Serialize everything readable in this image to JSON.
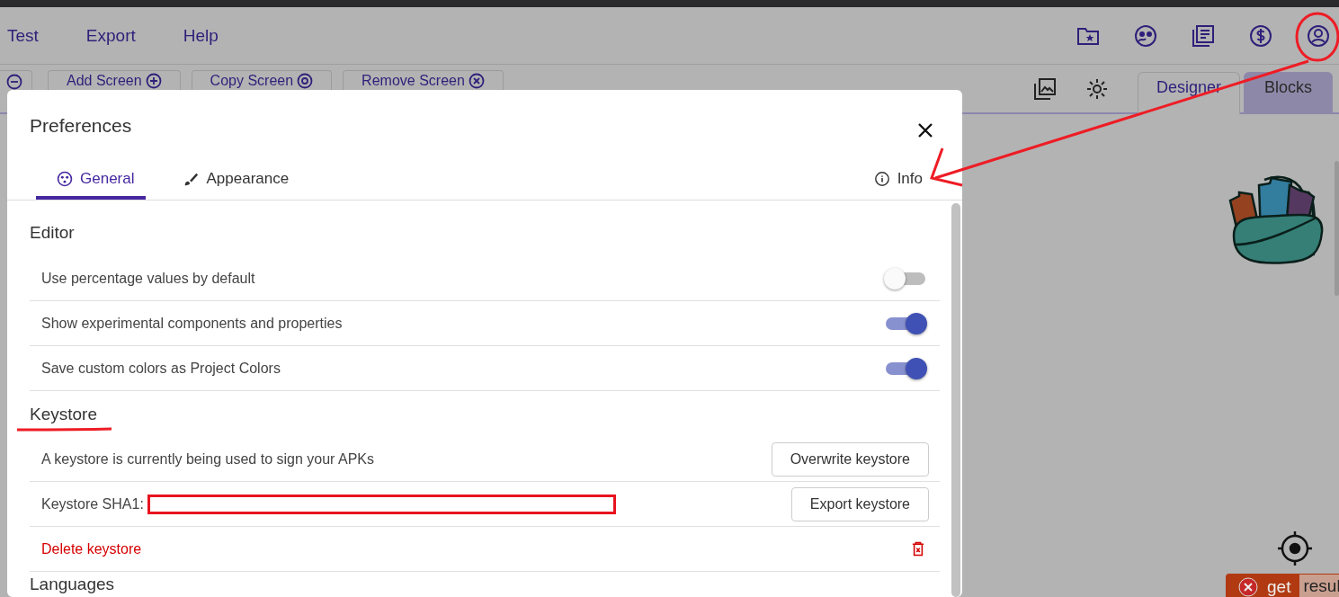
{
  "menu": [
    {
      "label": "Test"
    },
    {
      "label": "Export"
    },
    {
      "label": "Help"
    }
  ],
  "toolbar": {
    "buttons": [
      {
        "label": "Add Screen"
      },
      {
        "label": "Copy Screen"
      },
      {
        "label": "Remove Screen"
      }
    ],
    "view_tabs": [
      {
        "label": "Designer",
        "selected": false
      },
      {
        "label": "Blocks",
        "selected": true
      }
    ]
  },
  "canvas": {
    "block": {
      "label": "get",
      "argument": "resul"
    }
  },
  "dialog": {
    "title": "Preferences",
    "tabs": [
      {
        "label": "General",
        "selected": true
      },
      {
        "label": "Appearance",
        "selected": false
      },
      {
        "label": "Info",
        "selected": false
      }
    ],
    "sections": [
      {
        "heading": "Editor",
        "rows": [
          {
            "kind": "toggle",
            "label": "Use percentage values by default",
            "on": false
          },
          {
            "kind": "toggle",
            "label": "Show experimental components and properties",
            "on": true
          },
          {
            "kind": "toggle",
            "label": "Save custom colors as Project Colors",
            "on": true
          }
        ]
      },
      {
        "heading": "Keystore",
        "rows": [
          {
            "kind": "action",
            "label": "A keystore is currently being used to sign your APKs",
            "button": "Overwrite keystore"
          },
          {
            "kind": "hash",
            "label": "Keystore SHA1:",
            "button": "Export keystore"
          },
          {
            "kind": "danger",
            "label": "Delete keystore"
          }
        ]
      },
      {
        "heading": "Languages"
      }
    ]
  }
}
